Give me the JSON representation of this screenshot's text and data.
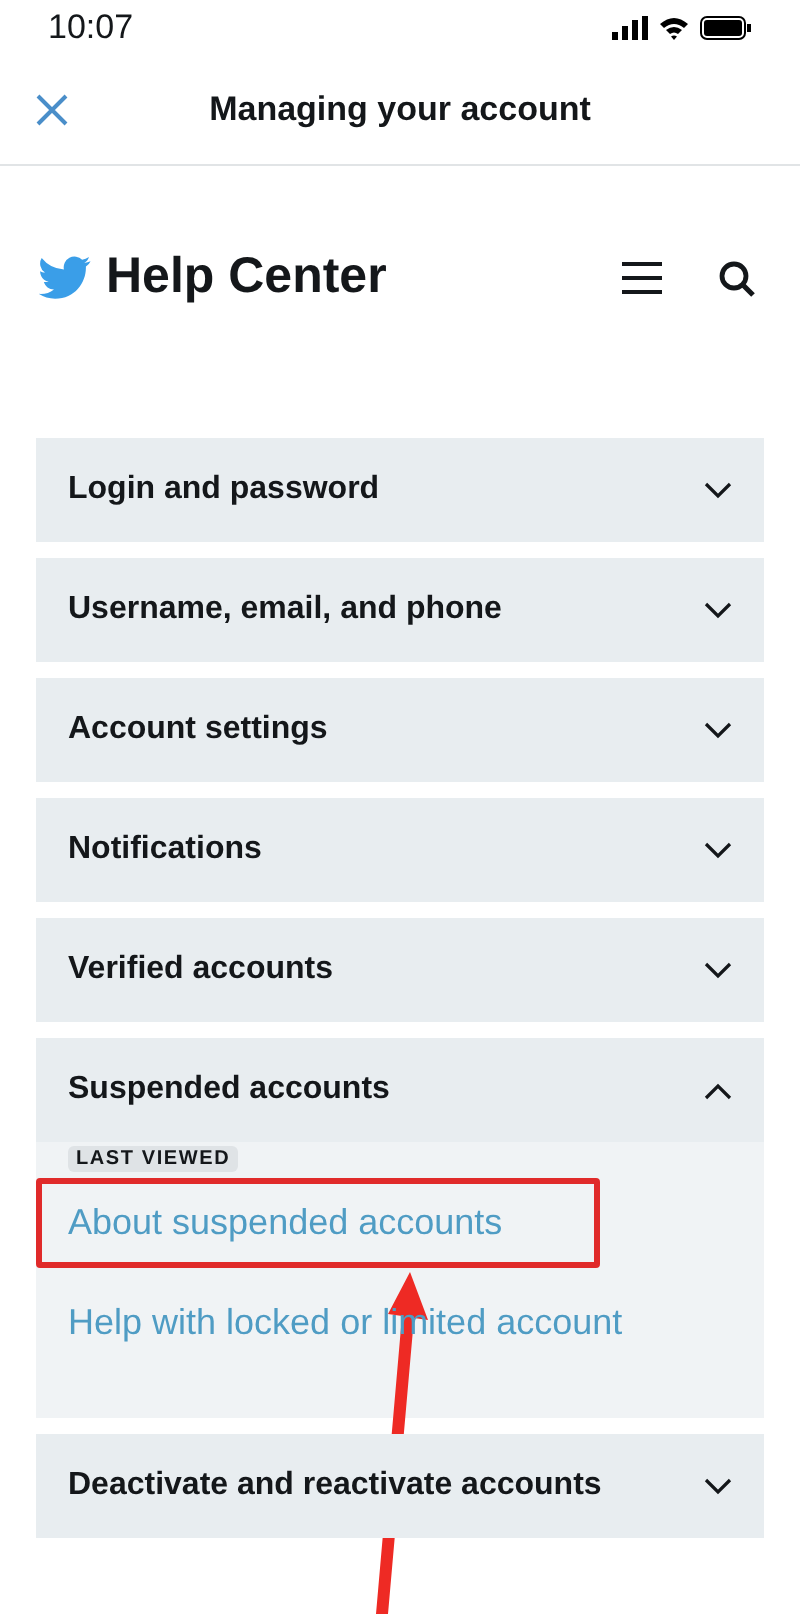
{
  "status_bar": {
    "time": "10:07"
  },
  "nav": {
    "title": "Managing your account"
  },
  "header": {
    "title": "Help Center"
  },
  "sections": [
    {
      "title": "Login and password",
      "expanded": false
    },
    {
      "title": "Username, email, and phone",
      "expanded": false
    },
    {
      "title": "Account settings",
      "expanded": false
    },
    {
      "title": "Notifications",
      "expanded": false
    },
    {
      "title": "Verified accounts",
      "expanded": false
    },
    {
      "title": "Suspended accounts",
      "expanded": true,
      "links": [
        {
          "text": "About suspended accounts",
          "badge": "LAST VIEWED",
          "highlighted": true
        },
        {
          "text": "Help with locked or limited account",
          "highlighted": false
        }
      ]
    },
    {
      "title": "Deactivate and reactivate accounts",
      "expanded": false
    }
  ]
}
